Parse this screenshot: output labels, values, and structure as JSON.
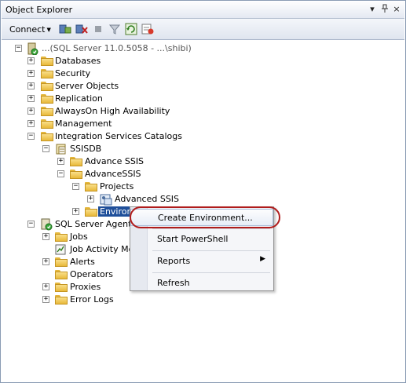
{
  "window": {
    "title": "Object Explorer",
    "pin_glyph": "▾",
    "dock_glyph": "ꟷ",
    "close_glyph": "×"
  },
  "toolbar": {
    "connect_label": "Connect"
  },
  "tree": {
    "server_label": "...(SQL Server 11.0.5058 - ...\\shibi)",
    "databases": "Databases",
    "security": "Security",
    "server_objects": "Server Objects",
    "replication": "Replication",
    "alwayson": "AlwaysOn High Availability",
    "management": "Management",
    "integration_catalogs": "Integration Services Catalogs",
    "ssisdb": "SSISDB",
    "advance_ssis_1": "Advance SSIS",
    "advancessis_2": "AdvanceSSIS",
    "projects": "Projects",
    "advanced_ssis": "Advanced SSIS",
    "environments_partial": "Environ",
    "sql_agent": "SQL Server Agent",
    "jobs": "Jobs",
    "job_activity": "Job Activity Mon",
    "alerts": "Alerts",
    "operators": "Operators",
    "proxies": "Proxies",
    "error_logs": "Error Logs"
  },
  "context_menu": {
    "create_env": "Create Environment...",
    "start_powershell": "Start PowerShell",
    "reports": "Reports",
    "refresh": "Refresh"
  },
  "colors": {
    "selection": "#1f4f9a",
    "callout": "#b01c1c"
  }
}
